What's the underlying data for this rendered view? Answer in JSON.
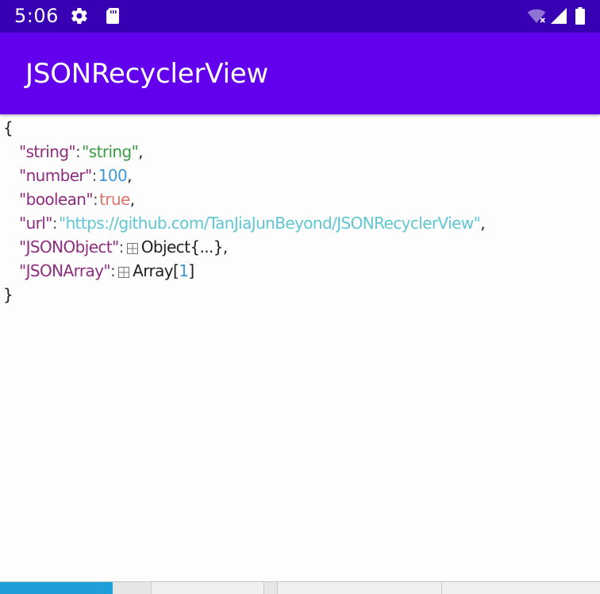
{
  "status_bar": {
    "time": "5:06",
    "icons": [
      "gear-icon",
      "sd-card-icon",
      "wifi-off-icon",
      "signal-icon",
      "battery-icon"
    ],
    "color": "#3700b3"
  },
  "app_bar": {
    "title": "JSONRecyclerView",
    "color": "#6200ee"
  },
  "json": {
    "open_brace": "{",
    "close_brace": "}",
    "rows": [
      {
        "key": "\"string\"",
        "colon": ":",
        "value": "\"string\"",
        "value_type": "string",
        "suffix": ","
      },
      {
        "key": "\"number\"",
        "colon": ":",
        "value": "100",
        "value_type": "number",
        "suffix": ","
      },
      {
        "key": "\"boolean\"",
        "colon": ":",
        "value": "true",
        "value_type": "boolean",
        "suffix": ","
      },
      {
        "key": "\"url\"",
        "colon": ":",
        "value": "\"https://github.com/TanJiaJunBeyond/JSONRecyclerView\"",
        "value_type": "url",
        "suffix": ","
      },
      {
        "key": "\"JSONObject\"",
        "colon": ":",
        "icon": "expand-icon",
        "label": "Object{...}",
        "suffix": ","
      },
      {
        "key": "\"JSONArray\"",
        "colon": ":",
        "icon": "expand-icon",
        "label": "Array[",
        "count": "1",
        "label_end": "]"
      }
    ],
    "colors": {
      "key": "#8e2c7e",
      "string": "#3a9c46",
      "number": "#3e9ad6",
      "boolean": "#e07468",
      "url": "#5ec7d2"
    }
  }
}
